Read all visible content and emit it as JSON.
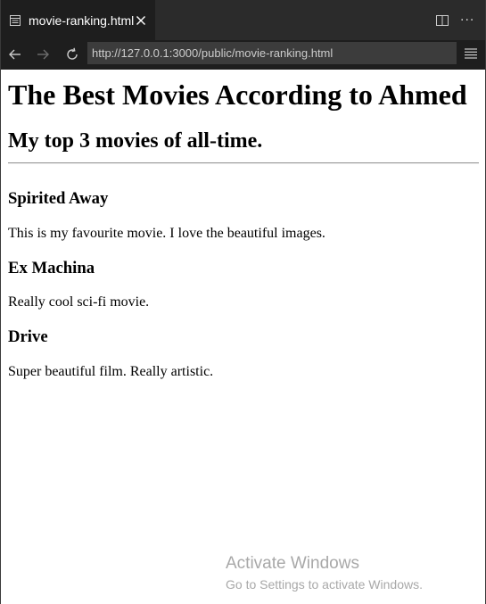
{
  "browser": {
    "tab": {
      "title": "movie-ranking.html",
      "icon": "page-preview-icon"
    },
    "toolbar_icons": {
      "close": "close-icon",
      "split": "split-editor-icon",
      "more": "more-actions-icon",
      "back": "arrow-left-icon",
      "forward": "arrow-right-icon",
      "reload": "reload-icon",
      "menu": "hamburger-menu-icon"
    },
    "url": "http://127.0.0.1:3000/public/movie-ranking.html",
    "more_glyph": "···"
  },
  "page": {
    "title": "The Best Movies According to Ahmed",
    "subtitle": "My top 3 movies of all-time.",
    "movies": [
      {
        "title": "Spirited Away",
        "description": "This is my favourite movie. I love the beautiful images."
      },
      {
        "title": "Ex Machina",
        "description": "Really cool sci-fi movie."
      },
      {
        "title": "Drive",
        "description": "Super beautiful film. Really artistic."
      }
    ]
  },
  "watermark": {
    "title": "Activate Windows",
    "subtitle": "Go to Settings to activate Windows."
  },
  "colors": {
    "tabbar_bg": "#2b2b2b",
    "active_tab_bg": "#1e1e1e",
    "url_bg": "#3c3c3c",
    "watermark_text": "#a8a8a8"
  }
}
